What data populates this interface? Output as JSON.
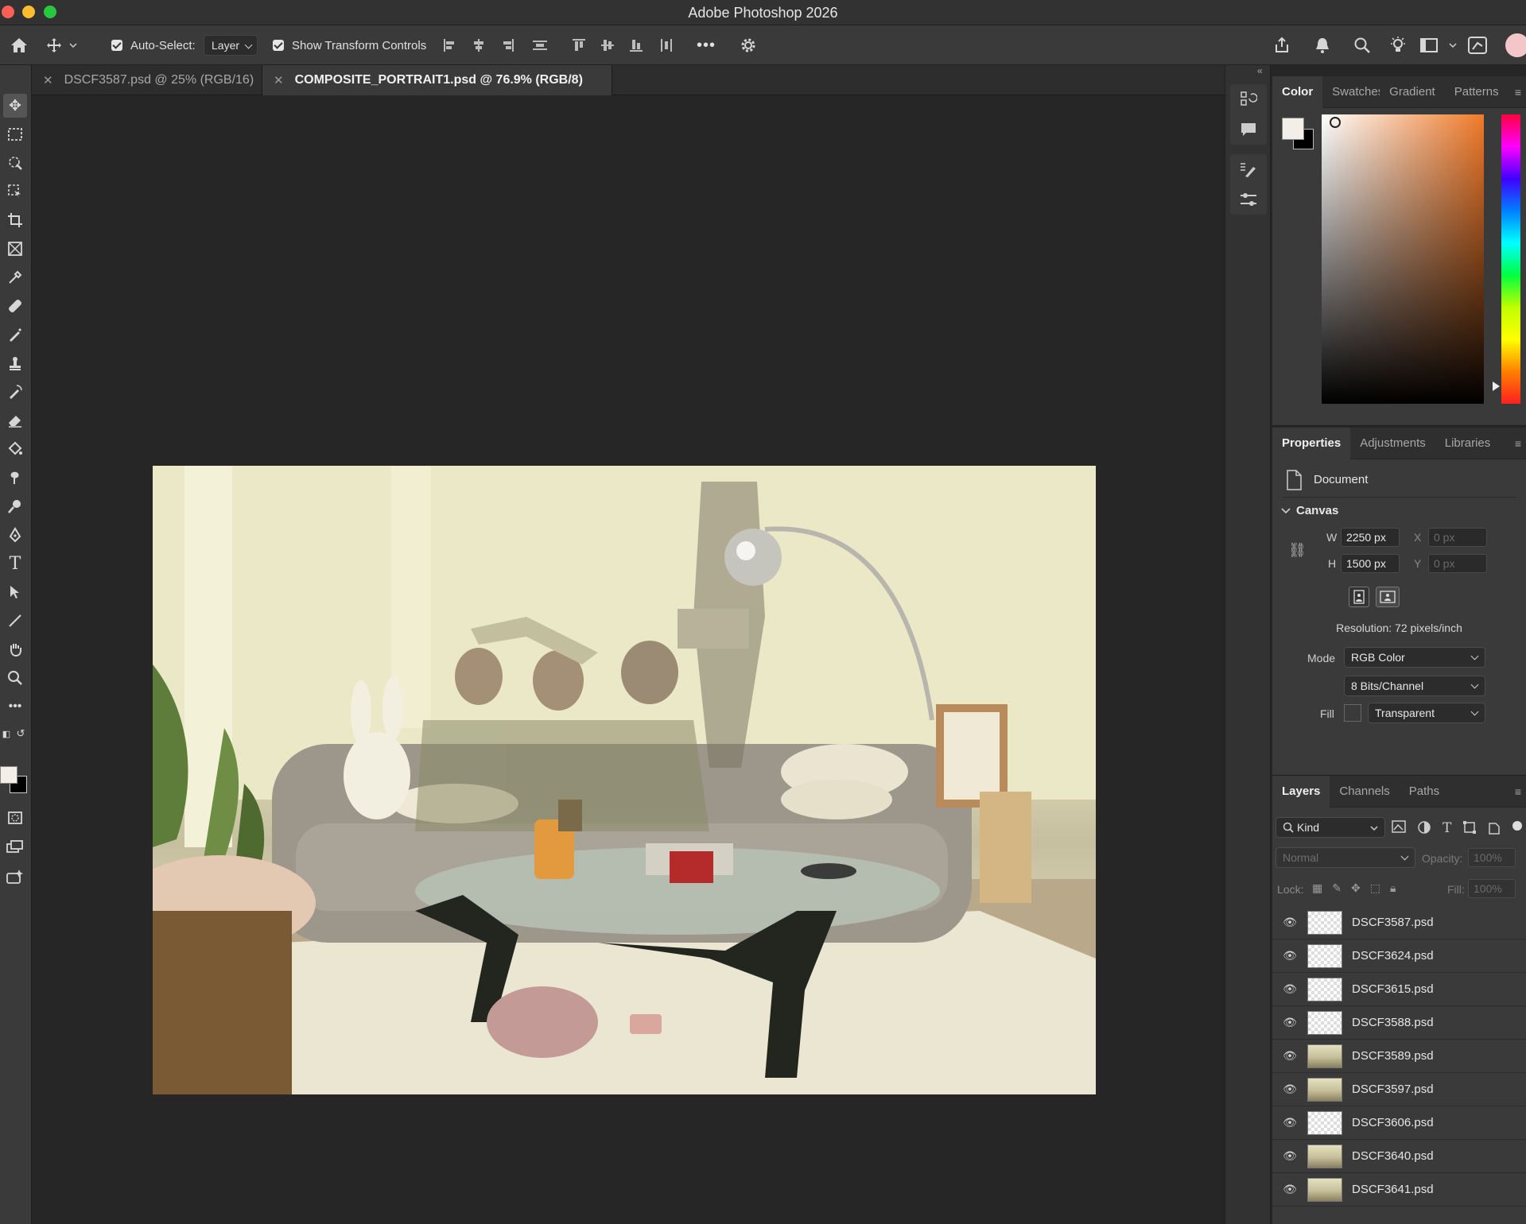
{
  "app": {
    "title": "Adobe Photoshop 2026"
  },
  "options_bar": {
    "auto_select_label": "Auto-Select:",
    "auto_select_value": "Layer",
    "transform_label": "Show Transform Controls",
    "more_label": "•••"
  },
  "tabs": [
    {
      "label": "DSCF3587.psd @ 25% (RGB/16)",
      "active": false
    },
    {
      "label": "COMPOSITE_PORTRAIT1.psd @ 76.9% (RGB/8)",
      "active": true
    }
  ],
  "color_panel": {
    "tabs": [
      "Color",
      "Swatches",
      "Gradient",
      "Patterns"
    ]
  },
  "properties_panel": {
    "tabs": [
      "Properties",
      "Adjustments",
      "Libraries"
    ],
    "document_label": "Document",
    "canvas_heading": "Canvas",
    "w_label": "W",
    "w_value": "2250 px",
    "h_label": "H",
    "h_value": "1500 px",
    "x_label": "X",
    "x_placeholder": "0 px",
    "y_label": "Y",
    "y_placeholder": "0 px",
    "resolution": "Resolution: 72 pixels/inch",
    "mode_label": "Mode",
    "mode_value": "RGB Color",
    "bits_value": "8 Bits/Channel",
    "fill_label": "Fill",
    "fill_value": "Transparent"
  },
  "layers_panel": {
    "tabs": [
      "Layers",
      "Channels",
      "Paths"
    ],
    "filter_kind": "Kind",
    "blend_mode": "Normal",
    "opacity_label": "Opacity:",
    "opacity_value": "100%",
    "lock_label": "Lock:",
    "fill_label": "Fill:",
    "fill_value": "100%",
    "layers": [
      {
        "name": "DSCF3587.psd",
        "thumb": "transparent"
      },
      {
        "name": "DSCF3624.psd",
        "thumb": "transparent"
      },
      {
        "name": "DSCF3615.psd",
        "thumb": "transparent"
      },
      {
        "name": "DSCF3588.psd",
        "thumb": "transparent"
      },
      {
        "name": "DSCF3589.psd",
        "thumb": "photo"
      },
      {
        "name": "DSCF3597.psd",
        "thumb": "photo"
      },
      {
        "name": "DSCF3606.psd",
        "thumb": "transparent"
      },
      {
        "name": "DSCF3640.psd",
        "thumb": "photo"
      },
      {
        "name": "DSCF3641.psd",
        "thumb": "photo"
      }
    ]
  },
  "colors": {
    "foreground": "#f3efe8",
    "background": "#000000",
    "accent_hue": "#f07a2a"
  }
}
